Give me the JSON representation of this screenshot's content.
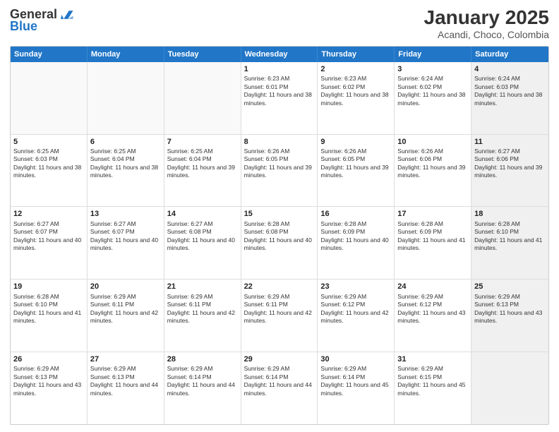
{
  "header": {
    "logo_general": "General",
    "logo_blue": "Blue",
    "title": "January 2025",
    "subtitle": "Acandi, Choco, Colombia"
  },
  "calendar": {
    "weekdays": [
      "Sunday",
      "Monday",
      "Tuesday",
      "Wednesday",
      "Thursday",
      "Friday",
      "Saturday"
    ],
    "rows": [
      [
        {
          "day": "",
          "info": "",
          "empty": true
        },
        {
          "day": "",
          "info": "",
          "empty": true
        },
        {
          "day": "",
          "info": "",
          "empty": true
        },
        {
          "day": "1",
          "info": "Sunrise: 6:23 AM\nSunset: 6:01 PM\nDaylight: 11 hours and 38 minutes."
        },
        {
          "day": "2",
          "info": "Sunrise: 6:23 AM\nSunset: 6:02 PM\nDaylight: 11 hours and 38 minutes."
        },
        {
          "day": "3",
          "info": "Sunrise: 6:24 AM\nSunset: 6:02 PM\nDaylight: 11 hours and 38 minutes."
        },
        {
          "day": "4",
          "info": "Sunrise: 6:24 AM\nSunset: 6:03 PM\nDaylight: 11 hours and 38 minutes.",
          "shaded": true
        }
      ],
      [
        {
          "day": "5",
          "info": "Sunrise: 6:25 AM\nSunset: 6:03 PM\nDaylight: 11 hours and 38 minutes."
        },
        {
          "day": "6",
          "info": "Sunrise: 6:25 AM\nSunset: 6:04 PM\nDaylight: 11 hours and 38 minutes."
        },
        {
          "day": "7",
          "info": "Sunrise: 6:25 AM\nSunset: 6:04 PM\nDaylight: 11 hours and 39 minutes."
        },
        {
          "day": "8",
          "info": "Sunrise: 6:26 AM\nSunset: 6:05 PM\nDaylight: 11 hours and 39 minutes."
        },
        {
          "day": "9",
          "info": "Sunrise: 6:26 AM\nSunset: 6:05 PM\nDaylight: 11 hours and 39 minutes."
        },
        {
          "day": "10",
          "info": "Sunrise: 6:26 AM\nSunset: 6:06 PM\nDaylight: 11 hours and 39 minutes."
        },
        {
          "day": "11",
          "info": "Sunrise: 6:27 AM\nSunset: 6:06 PM\nDaylight: 11 hours and 39 minutes.",
          "shaded": true
        }
      ],
      [
        {
          "day": "12",
          "info": "Sunrise: 6:27 AM\nSunset: 6:07 PM\nDaylight: 11 hours and 40 minutes."
        },
        {
          "day": "13",
          "info": "Sunrise: 6:27 AM\nSunset: 6:07 PM\nDaylight: 11 hours and 40 minutes."
        },
        {
          "day": "14",
          "info": "Sunrise: 6:27 AM\nSunset: 6:08 PM\nDaylight: 11 hours and 40 minutes."
        },
        {
          "day": "15",
          "info": "Sunrise: 6:28 AM\nSunset: 6:08 PM\nDaylight: 11 hours and 40 minutes."
        },
        {
          "day": "16",
          "info": "Sunrise: 6:28 AM\nSunset: 6:09 PM\nDaylight: 11 hours and 40 minutes."
        },
        {
          "day": "17",
          "info": "Sunrise: 6:28 AM\nSunset: 6:09 PM\nDaylight: 11 hours and 41 minutes."
        },
        {
          "day": "18",
          "info": "Sunrise: 6:28 AM\nSunset: 6:10 PM\nDaylight: 11 hours and 41 minutes.",
          "shaded": true
        }
      ],
      [
        {
          "day": "19",
          "info": "Sunrise: 6:28 AM\nSunset: 6:10 PM\nDaylight: 11 hours and 41 minutes."
        },
        {
          "day": "20",
          "info": "Sunrise: 6:29 AM\nSunset: 6:11 PM\nDaylight: 11 hours and 42 minutes."
        },
        {
          "day": "21",
          "info": "Sunrise: 6:29 AM\nSunset: 6:11 PM\nDaylight: 11 hours and 42 minutes."
        },
        {
          "day": "22",
          "info": "Sunrise: 6:29 AM\nSunset: 6:11 PM\nDaylight: 11 hours and 42 minutes."
        },
        {
          "day": "23",
          "info": "Sunrise: 6:29 AM\nSunset: 6:12 PM\nDaylight: 11 hours and 42 minutes."
        },
        {
          "day": "24",
          "info": "Sunrise: 6:29 AM\nSunset: 6:12 PM\nDaylight: 11 hours and 43 minutes."
        },
        {
          "day": "25",
          "info": "Sunrise: 6:29 AM\nSunset: 6:13 PM\nDaylight: 11 hours and 43 minutes.",
          "shaded": true
        }
      ],
      [
        {
          "day": "26",
          "info": "Sunrise: 6:29 AM\nSunset: 6:13 PM\nDaylight: 11 hours and 43 minutes."
        },
        {
          "day": "27",
          "info": "Sunrise: 6:29 AM\nSunset: 6:13 PM\nDaylight: 11 hours and 44 minutes."
        },
        {
          "day": "28",
          "info": "Sunrise: 6:29 AM\nSunset: 6:14 PM\nDaylight: 11 hours and 44 minutes."
        },
        {
          "day": "29",
          "info": "Sunrise: 6:29 AM\nSunset: 6:14 PM\nDaylight: 11 hours and 44 minutes."
        },
        {
          "day": "30",
          "info": "Sunrise: 6:29 AM\nSunset: 6:14 PM\nDaylight: 11 hours and 45 minutes."
        },
        {
          "day": "31",
          "info": "Sunrise: 6:29 AM\nSunset: 6:15 PM\nDaylight: 11 hours and 45 minutes."
        },
        {
          "day": "",
          "info": "",
          "empty": true,
          "shaded": true
        }
      ]
    ]
  }
}
